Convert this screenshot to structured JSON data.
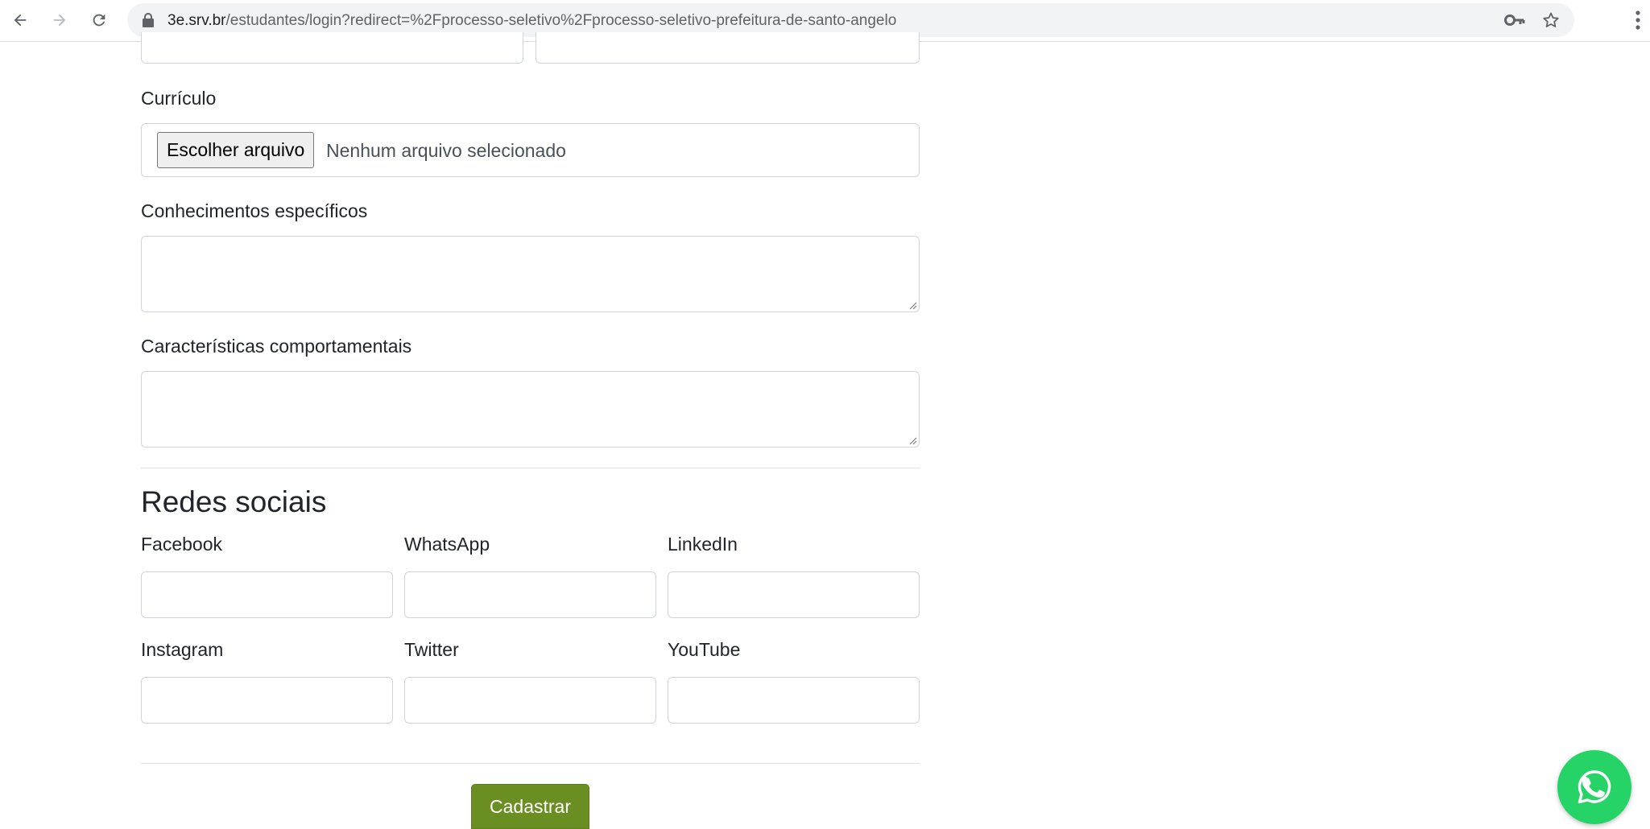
{
  "browser": {
    "url_host": "3e.srv.br",
    "url_path": "/estudantes/login?redirect=%2Fprocesso-seletivo%2Fprocesso-seletivo-prefeitura-de-santo-angelo"
  },
  "form": {
    "curriculo": {
      "label": "Currículo",
      "button_label": "Escolher arquivo",
      "status": "Nenhum arquivo selecionado"
    },
    "conhecimentos": {
      "label": "Conhecimentos específicos"
    },
    "caracteristicas": {
      "label": "Características comportamentais"
    },
    "social": {
      "title": "Redes sociais",
      "fields": [
        {
          "label": "Facebook"
        },
        {
          "label": "WhatsApp"
        },
        {
          "label": "LinkedIn"
        },
        {
          "label": "Instagram"
        },
        {
          "label": "Twitter"
        },
        {
          "label": "YouTube"
        }
      ]
    },
    "submit_label": "Cadastrar"
  },
  "colors": {
    "submit": "#6b8e23",
    "whatsapp": "#25d366"
  }
}
